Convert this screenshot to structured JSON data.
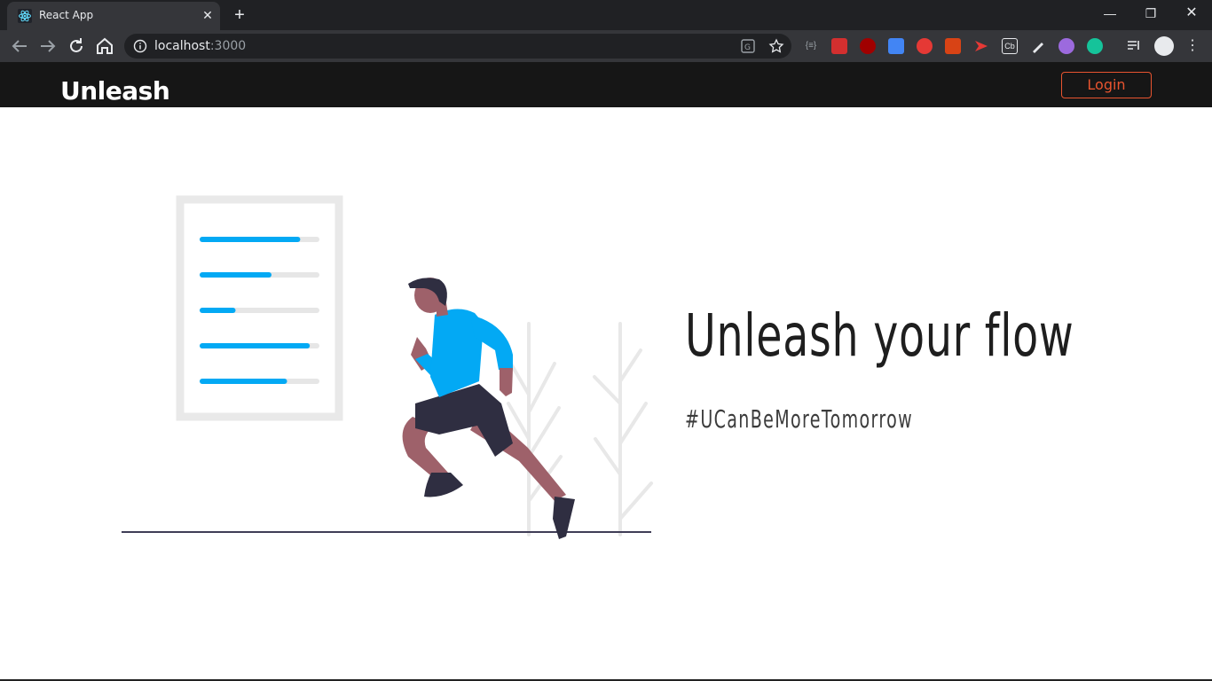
{
  "browser": {
    "tab_title": "React App",
    "url_host": "localhost",
    "url_port": ":3000",
    "window_controls": [
      "minimize-icon",
      "restore-icon",
      "close-icon"
    ]
  },
  "app": {
    "brand": "Unleash",
    "login_label": "Login",
    "accent_color": "#e8542f",
    "header_bg": "#161616"
  },
  "hero": {
    "title": "Unleash your flow",
    "tagline": "#UCanBeMoreTomorrow",
    "illustration": "runner-with-progress-list",
    "progress_bars": [
      0.84,
      0.6,
      0.3,
      0.92,
      0.73
    ],
    "progress_color": "#03a9f4"
  }
}
